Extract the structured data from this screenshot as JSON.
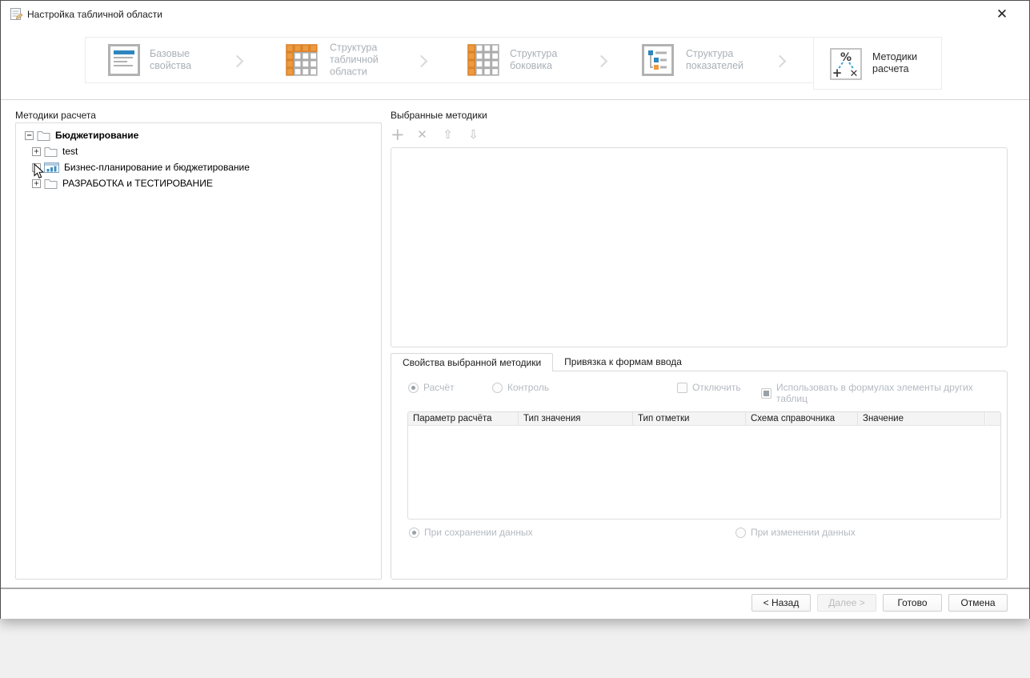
{
  "window": {
    "title": "Настройка табличной области",
    "close_glyph": "✕"
  },
  "wizard_steps": [
    {
      "label": "Базовые свойства",
      "icon": "document-icon",
      "state": "inactive"
    },
    {
      "label": "Структура табличной области",
      "icon": "table-area-icon",
      "state": "inactive"
    },
    {
      "label": "Структура боковика",
      "icon": "sidebar-structure-icon",
      "state": "inactive"
    },
    {
      "label": "Структура показателей",
      "icon": "indicators-structure-icon",
      "state": "inactive"
    },
    {
      "label": "Методики расчета",
      "icon": "calc-methods-icon",
      "state": "active"
    }
  ],
  "left_panel": {
    "title": "Методики расчета",
    "tree": [
      {
        "label": "Бюджетирование",
        "icon": "folder-icon",
        "expander": "−",
        "bold": true
      },
      {
        "label": "test",
        "icon": "folder-icon",
        "expander": "+"
      },
      {
        "label": "Бизнес-планирование и бюджетирование",
        "icon": "chart-icon",
        "expander": "+"
      },
      {
        "label": "РАЗРАБОТКА и ТЕСТИРОВАНИЕ",
        "icon": "folder-icon",
        "expander": "+"
      }
    ]
  },
  "right_panel": {
    "title": "Выбранные методики",
    "toolbar": [
      {
        "icon": "add-icon",
        "glyph": "+"
      },
      {
        "icon": "remove-icon",
        "glyph": "✕"
      },
      {
        "icon": "move-up-icon",
        "glyph": "⇧"
      },
      {
        "icon": "move-down-icon",
        "glyph": "⇩"
      }
    ]
  },
  "tabs": [
    {
      "label": "Свойства выбранной методики",
      "active": true
    },
    {
      "label": "Привязка к формам ввода",
      "active": false
    }
  ],
  "properties": {
    "radio_calc": "Расчёт",
    "radio_control": "Контроль",
    "check_disable": "Отключить",
    "check_use_formulas": "Использовать в формулах элементы других таблиц",
    "table_headers": [
      "Параметр расчёта",
      "Тип значения",
      "Тип отметки",
      "Схема справочника",
      "Значение"
    ],
    "radio_on_save": "При сохранении данных",
    "radio_on_change": "При изменении данных"
  },
  "footer": {
    "back": "< Назад",
    "next": "Далее >",
    "finish": "Готово",
    "cancel": "Отмена"
  },
  "colors": {
    "accent_orange": "#ED9B40",
    "accent_blue": "#2E86BD",
    "dashed_blue": "#3BA3DC",
    "disabled_text": "#B4BAC1"
  }
}
